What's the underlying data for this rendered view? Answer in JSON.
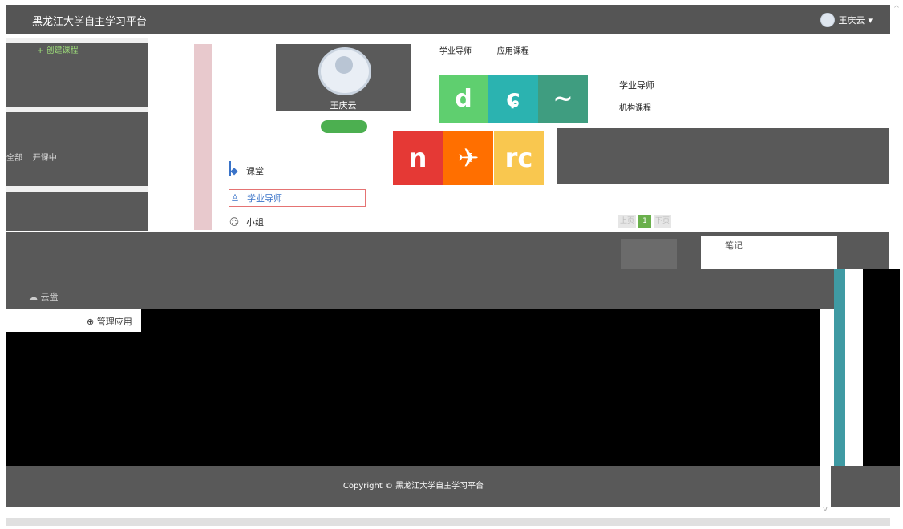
{
  "header": {
    "brand": "黑龙江大学自主学习平台",
    "user_name": "王庆云",
    "user_caret": "▾"
  },
  "left": {
    "create_button": "+ 创建课程",
    "tabs": [
      "全部",
      "开课中"
    ]
  },
  "profile": {
    "name": "王庆云"
  },
  "menu": {
    "items": [
      {
        "label": "课堂",
        "icon": "graduation-cap-icon",
        "glyph": "◆"
      },
      {
        "label": "学业导师",
        "icon": "tutor-icon",
        "glyph": "♙"
      },
      {
        "label": "小组",
        "icon": "group-icon",
        "glyph": "☺"
      }
    ],
    "more_items": [
      {
        "label": "云盘",
        "glyph": "☁"
      }
    ],
    "manage_label": "管理应用"
  },
  "tabs_top": {
    "label1": "学业导师",
    "label2": "应用课程"
  },
  "app": {
    "title": "学业导师",
    "subtitle": "机构课程"
  },
  "pager": {
    "prev": "上页",
    "current": "1",
    "next": "下页"
  },
  "float": {
    "label": "笔记"
  },
  "footer": {
    "copyright": "Copyright © 黑龙江大学自主学习平台"
  },
  "colors": {
    "tile_green": "#5fcf6f",
    "tile_teal": "#2bb3b0",
    "tile_darkteal": "#3f9d80",
    "tile_red": "#e53935",
    "tile_orange": "#ff6f00",
    "tile_yellow": "#f9c74f"
  }
}
